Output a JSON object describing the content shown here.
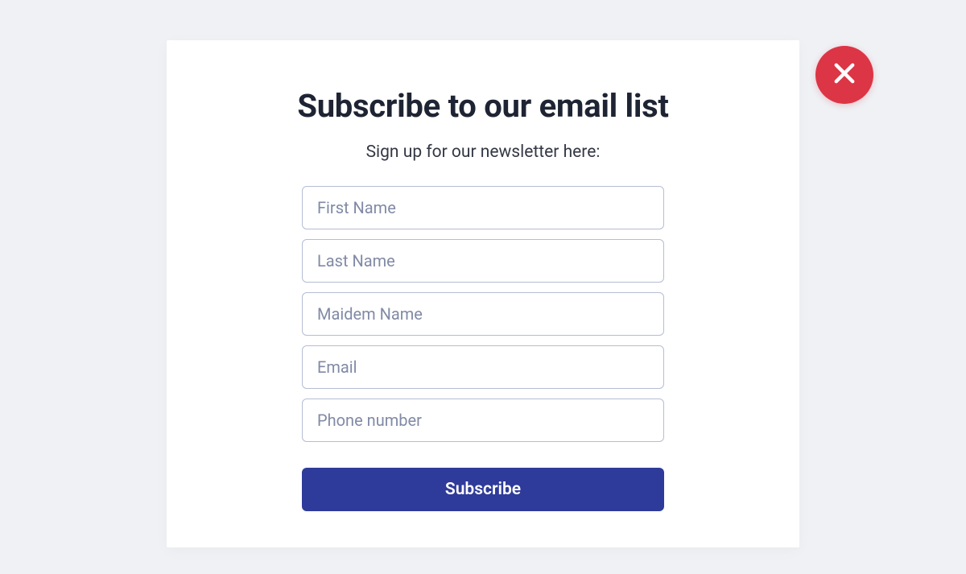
{
  "modal": {
    "title": "Subscribe to our email list",
    "subtitle": "Sign up for our newsletter here:",
    "fields": {
      "first_name": {
        "placeholder": "First Name",
        "value": ""
      },
      "last_name": {
        "placeholder": "Last Name",
        "value": ""
      },
      "maiden_name": {
        "placeholder": "Maidem Name",
        "value": ""
      },
      "email": {
        "placeholder": "Email",
        "value": ""
      },
      "phone": {
        "placeholder": "Phone number",
        "value": ""
      }
    },
    "submit_label": "Subscribe"
  },
  "close_icon": "close-icon",
  "colors": {
    "page_bg": "#eff1f5",
    "modal_bg": "#ffffff",
    "title_color": "#1e2433",
    "subtitle_color": "#333845",
    "input_border": "#b5bdd4",
    "placeholder": "#818aa6",
    "button_bg": "#2f3b9a",
    "button_text": "#ffffff",
    "close_bg": "#dc3545",
    "close_icon_color": "#ffffff"
  }
}
